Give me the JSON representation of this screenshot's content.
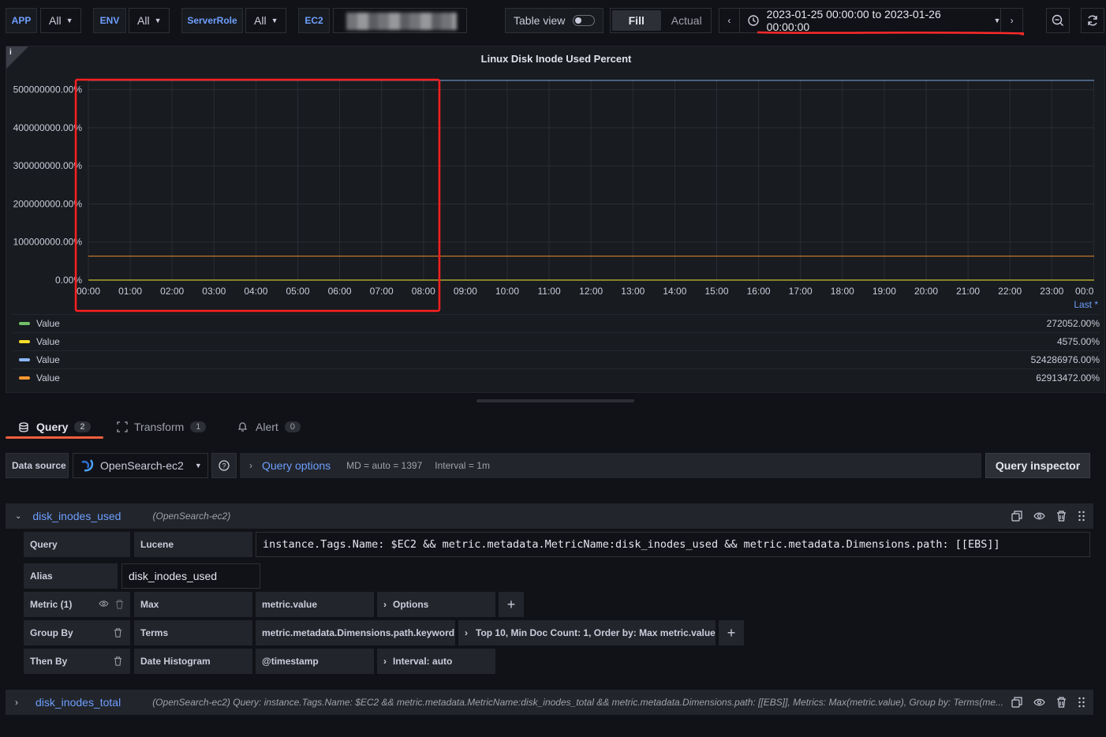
{
  "variables": [
    {
      "label": "APP",
      "value": "All"
    },
    {
      "label": "ENV",
      "value": "All"
    },
    {
      "label": "ServerRole",
      "value": "All"
    },
    {
      "label": "EC2",
      "value": ""
    }
  ],
  "toolbar": {
    "table_view_label": "Table view",
    "fill_label": "Fill",
    "actual_label": "Actual",
    "time_range": "2023-01-25 00:00:00 to 2023-01-26 00:00:00"
  },
  "panel": {
    "title": "Linux Disk Inode Used Percent",
    "legend_header": "Last *",
    "legend": [
      {
        "name": "Value",
        "color": "#73bf69",
        "last": "272052.00%"
      },
      {
        "name": "Value",
        "color": "#fade2a",
        "last": "4575.00%"
      },
      {
        "name": "Value",
        "color": "#8ab8ff",
        "last": "524286976.00%"
      },
      {
        "name": "Value",
        "color": "#ff9830",
        "last": "62913472.00%"
      }
    ]
  },
  "chart_data": {
    "type": "line",
    "title": "Linux Disk Inode Used Percent",
    "xlabel": "",
    "ylabel": "",
    "x_ticks": [
      "00:00",
      "01:00",
      "02:00",
      "03:00",
      "04:00",
      "05:00",
      "06:00",
      "07:00",
      "08:00",
      "09:00",
      "10:00",
      "11:00",
      "12:00",
      "13:00",
      "14:00",
      "15:00",
      "16:00",
      "17:00",
      "18:00",
      "19:00",
      "20:00",
      "21:00",
      "22:00",
      "23:00",
      "00:0"
    ],
    "y_ticks": [
      "0.00%",
      "100000000.00%",
      "200000000.00%",
      "300000000.00%",
      "400000000.00%",
      "500000000.00%"
    ],
    "ylim": [
      0,
      520000000
    ],
    "series": [
      {
        "color": "#73bf69",
        "values": [
          272052,
          272052
        ]
      },
      {
        "color": "#fade2a",
        "values": [
          4575,
          4575
        ]
      },
      {
        "color": "#8ab8ff",
        "values": [
          524286976,
          524286976
        ]
      },
      {
        "color": "#ff9830",
        "values": [
          62913472,
          62913472
        ]
      }
    ],
    "grid": true,
    "legend": "bottom"
  },
  "tabs": [
    {
      "label": "Query",
      "count": "2"
    },
    {
      "label": "Transform",
      "count": "1"
    },
    {
      "label": "Alert",
      "count": "0"
    }
  ],
  "datasource": {
    "label": "Data source",
    "name": "OpenSearch-ec2",
    "query_options_label": "Query options",
    "md_info": "MD = auto = 1397",
    "interval_info": "Interval = 1m",
    "inspector_label": "Query inspector"
  },
  "query_a": {
    "ref": "disk_inodes_used",
    "source": "(OpenSearch-ec2)",
    "query_label": "Query",
    "lucene_label": "Lucene",
    "query_text": "instance.Tags.Name: $EC2 && metric.metadata.MetricName:disk_inodes_used && metric.metadata.Dimensions.path: [[EBS]]",
    "alias_label": "Alias",
    "alias_value": "disk_inodes_used",
    "metric_label": "Metric (1)",
    "metric_type": "Max",
    "metric_field": "metric.value",
    "options_label": "Options",
    "groupby_label": "Group By",
    "groupby_type": "Terms",
    "groupby_field": "metric.metadata.Dimensions.path.keyword",
    "groupby_options": "Top 10, Min Doc Count: 1, Order by: Max metric.value",
    "thenby_label": "Then By",
    "thenby_type": "Date Histogram",
    "thenby_field": "@timestamp",
    "thenby_options": "Interval: auto"
  },
  "query_b": {
    "ref": "disk_inodes_total",
    "summary": "(OpenSearch-ec2)  Query: instance.Tags.Name: $EC2 && metric.metadata.MetricName:disk_inodes_total && metric.metadata.Dimensions.path: [[EBS]], Metrics: Max(metric.value), Group by: Terms(me..."
  }
}
